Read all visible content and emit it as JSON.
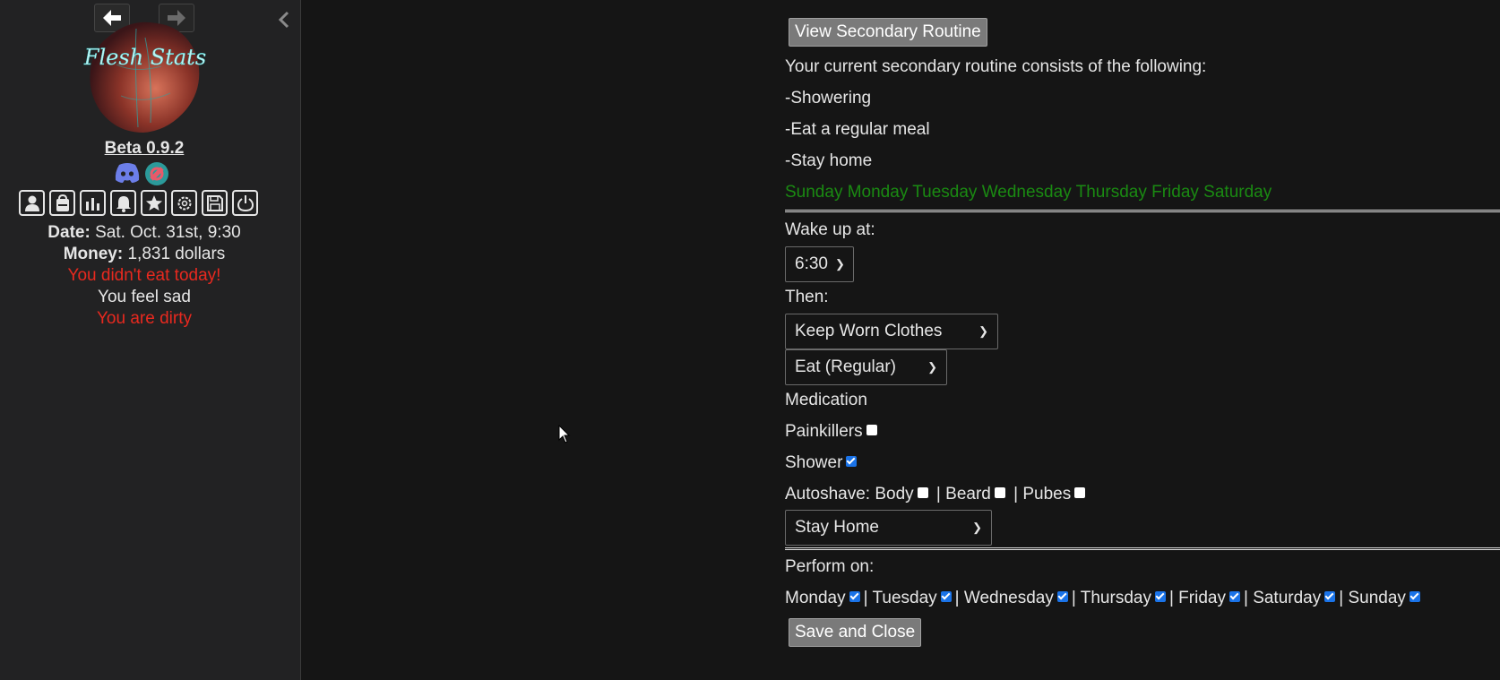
{
  "sidebar": {
    "logo_text": "Flesh Stats",
    "version": "Beta 0.9.2",
    "stats": {
      "date_label": "Date:",
      "date_value": " Sat. Oct. 31st, 9:30",
      "money_label": "Money:",
      "money_value": " 1,831 dollars",
      "status1": "You didn't eat today!",
      "status2": "You feel sad",
      "status3": "You are dirty"
    }
  },
  "main": {
    "view_button": "View Secondary Routine",
    "intro": "Your current secondary routine consists of the following:",
    "items": [
      "-Showering",
      "-Eat a regular meal",
      "-Stay home"
    ],
    "days_line": "Sunday Monday Tuesday Wednesday Thursday Friday Saturday",
    "wake_label": "Wake up at:",
    "wake_value": "6:30",
    "then_label": "Then:",
    "clothes_value": "Keep Worn Clothes",
    "eat_value": "Eat (Regular)",
    "medication_label": "Medication",
    "painkillers_label": "Painkillers",
    "shower_label": "Shower",
    "autoshave_label": "Autoshave: Body",
    "beard_label": " | Beard",
    "pubes_label": " | Pubes",
    "location_value": "Stay Home",
    "perform_label": "Perform on:",
    "weekdays": [
      "Monday",
      "Tuesday",
      "Wednesday",
      "Thursday",
      "Friday",
      "Saturday",
      "Sunday"
    ],
    "save_button": "Save and Close"
  },
  "colors": {
    "accent_red": "#e8291f",
    "accent_green": "#1a8a12",
    "checkbox_blue": "#1a73e8"
  }
}
